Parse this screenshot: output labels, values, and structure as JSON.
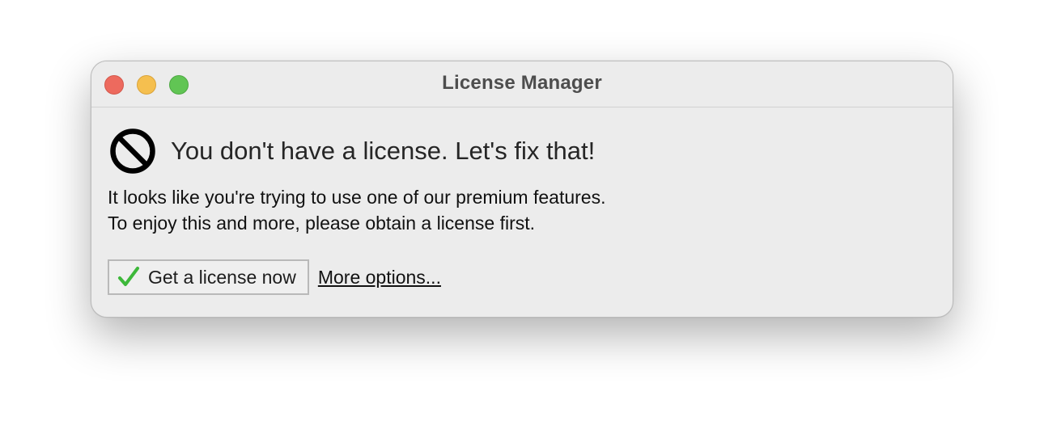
{
  "window": {
    "title": "License Manager",
    "controls": {
      "close": "close-button",
      "minimize": "minimize-button",
      "zoom": "zoom-button"
    }
  },
  "message": {
    "icon": "no-entry-icon",
    "headline": "You don't have a license. Let's fix that!",
    "body_line1": "It looks like you're trying to use one of our premium features.",
    "body_line2": "To enjoy this and more, please obtain a license first."
  },
  "actions": {
    "primary_label": "Get a license now",
    "primary_icon": "checkmark-icon",
    "link_label": "More options..."
  },
  "colors": {
    "close": "#ed6a5e",
    "minimize": "#f5bf4f",
    "zoom": "#61c554",
    "checkmark": "#3db83a"
  }
}
